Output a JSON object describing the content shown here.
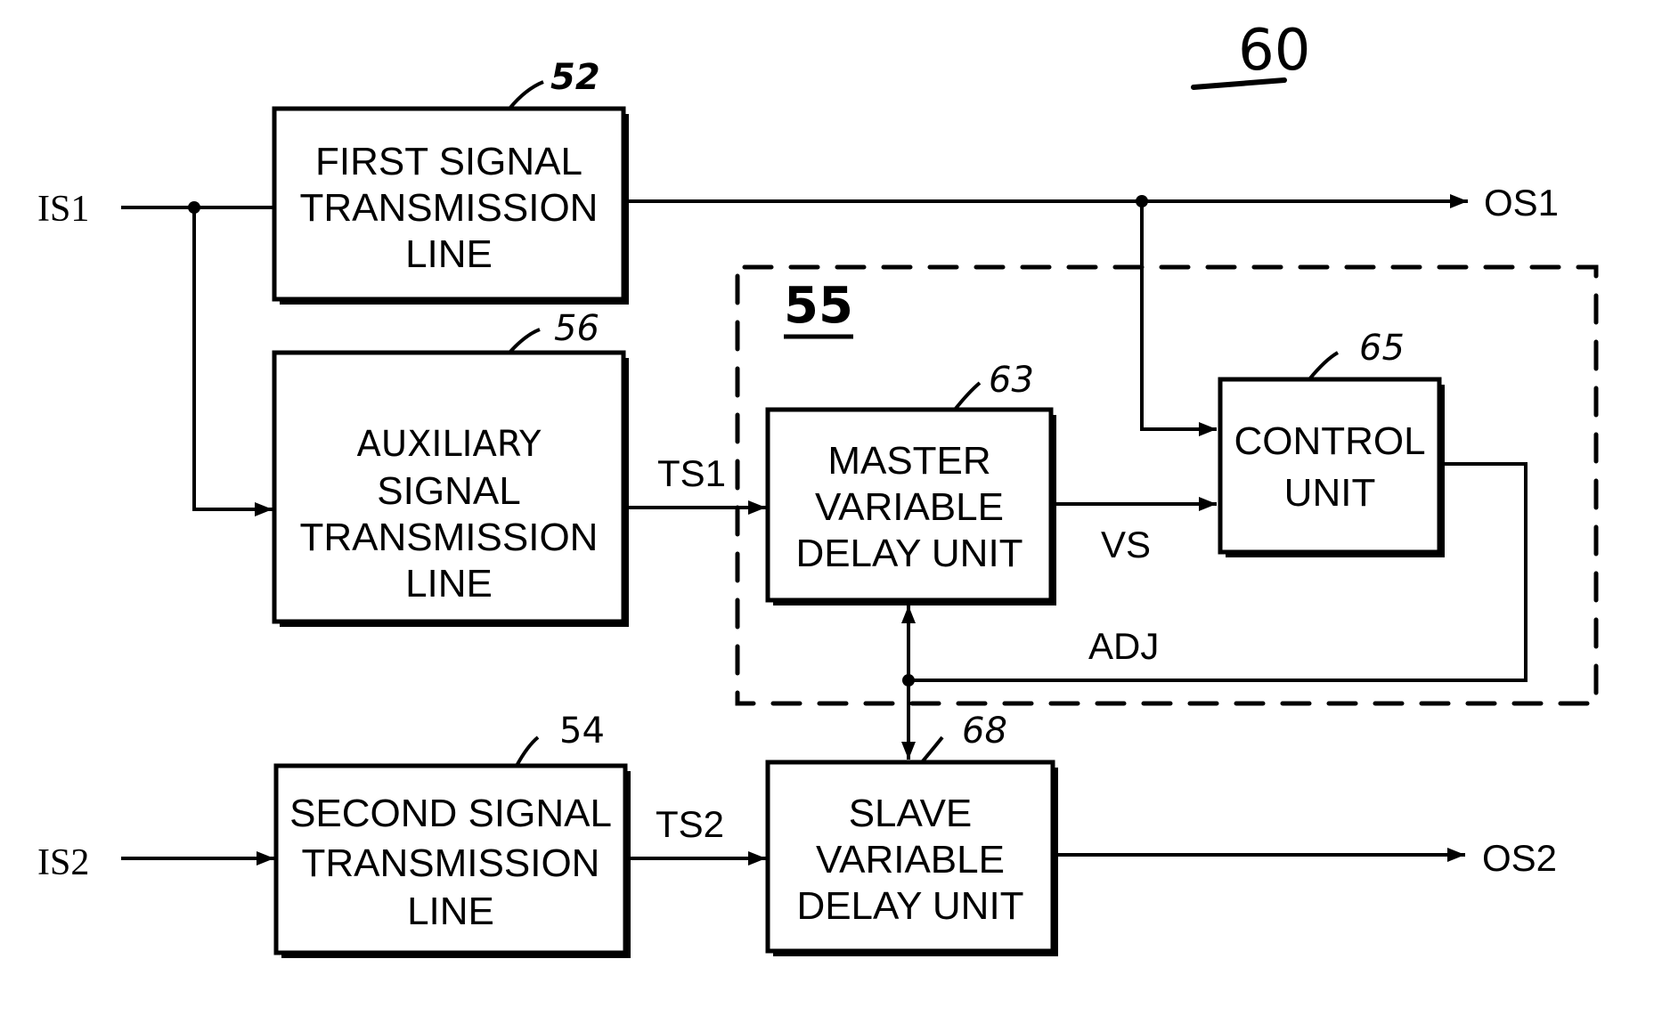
{
  "figure": {
    "number": "60",
    "group": {
      "ref": "55"
    }
  },
  "blocks": {
    "first_line": {
      "ref": "52",
      "lines": [
        "FIRST SIGNAL",
        "TRANSMISSION",
        "LINE"
      ]
    },
    "aux_line": {
      "ref": "56",
      "lines": [
        "AUXILIARY",
        "SIGNAL",
        "TRANSMISSION",
        "LINE"
      ]
    },
    "second_line": {
      "ref": "54",
      "lines": [
        "SECOND SIGNAL",
        "TRANSMISSION",
        "LINE"
      ]
    },
    "master": {
      "ref": "63",
      "lines": [
        "MASTER",
        "VARIABLE",
        "DELAY UNIT"
      ]
    },
    "slave": {
      "ref": "68",
      "lines": [
        "SLAVE",
        "VARIABLE",
        "DELAY UNIT"
      ]
    },
    "control": {
      "ref": "65",
      "lines": [
        "CONTROL",
        "UNIT"
      ]
    }
  },
  "signals": {
    "is1": "IS1",
    "is2": "IS2",
    "os1": "OS1",
    "os2": "OS2",
    "ts1": "TS1",
    "ts2": "TS2",
    "vs": "VS",
    "adj": "ADJ"
  }
}
